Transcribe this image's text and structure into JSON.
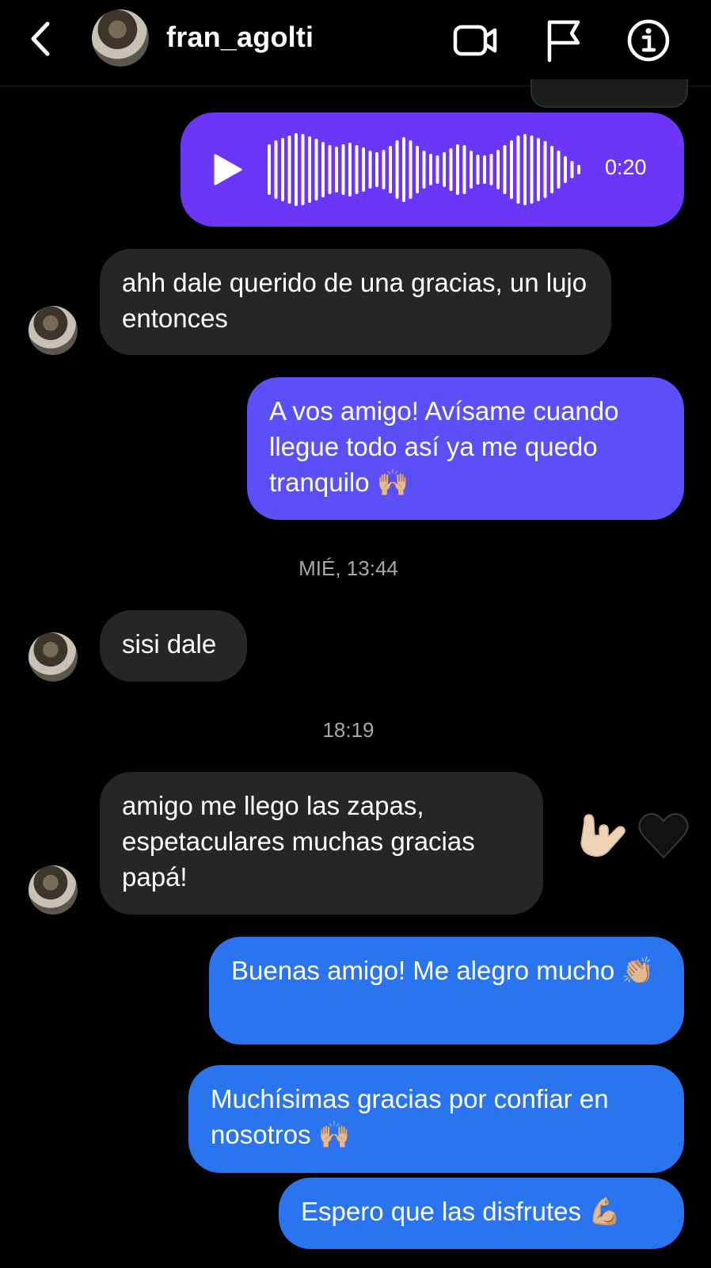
{
  "header": {
    "username": "fran_agolti",
    "icons": [
      "back-chevron-icon",
      "video-call-icon",
      "flag-icon",
      "info-icon"
    ]
  },
  "voice_message": {
    "duration": "0:20"
  },
  "timestamps": {
    "first": "MIÉ, 13:44",
    "second": "18:19"
  },
  "messages": [
    {
      "dir": "in",
      "text": "ahh dale querido de una gracias, un lujo entonces"
    },
    {
      "dir": "out",
      "text": "A vos amigo! Avísame cuando llegue todo así ya me quedo tranquilo 🙌🏼"
    },
    {
      "dir": "in",
      "text": "sisi dale"
    },
    {
      "dir": "in",
      "text": "amigo me llego las zapas, espetaculares muchas gracias papá!"
    },
    {
      "dir": "out",
      "text": "Buenas amigo! Me alegro mucho 👏🏼"
    },
    {
      "dir": "out",
      "text": "Muchísimas gracias por confiar en nosotros 🙌🏼"
    },
    {
      "dir": "out",
      "text": "Espero que las disfrutes 💪🏼"
    }
  ],
  "reactions": [
    "🤟🏼",
    "🖤"
  ],
  "colors": {
    "background": "#000000",
    "incoming_bubble": "#262626",
    "voice_bubble": "#6b36f8",
    "purple_bubble": "#5b4ff7",
    "blue_bubble": "#2a74f0",
    "timestamp_text": "#a8a8a8"
  }
}
